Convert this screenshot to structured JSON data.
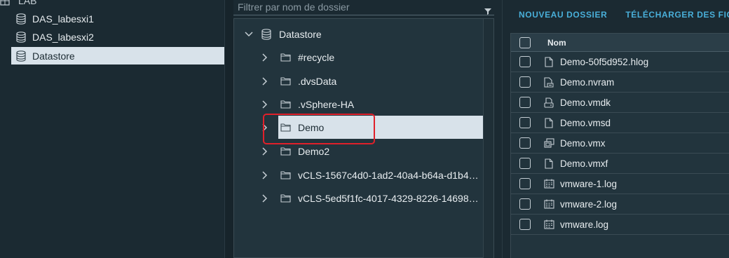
{
  "inventory": {
    "top_label": "LAB",
    "items": [
      {
        "label": "DAS_labesxi1",
        "icon": "datastore-icon"
      },
      {
        "label": "DAS_labesxi2",
        "icon": "datastore-icon"
      },
      {
        "label": "Datastore",
        "icon": "datastore-icon",
        "selected": true
      }
    ]
  },
  "filter": {
    "placeholder": "Filtrer par nom de dossier",
    "icon": "filter-icon"
  },
  "tree": {
    "root": {
      "label": "Datastore",
      "icon": "datastore-icon",
      "expanded": true
    },
    "folders": [
      {
        "label": "#recycle"
      },
      {
        "label": ".dvsData"
      },
      {
        "label": ".vSphere-HA"
      },
      {
        "label": "Demo",
        "selected": true
      },
      {
        "label": "Demo2"
      },
      {
        "label": "vCLS-1567c4d0-1ad2-40a4-b64a-d1b4aa..."
      },
      {
        "label": "vCLS-5ed5f1fc-4017-4329-8226-146988d..."
      }
    ]
  },
  "actions": {
    "new_folder": "NOUVEAU DOSSIER",
    "download": "TÉLÉCHARGER DES FICHI"
  },
  "files": {
    "column_name": "Nom",
    "rows": [
      {
        "name": "Demo-50f5d952.hlog",
        "icon": "file-icon"
      },
      {
        "name": "Demo.nvram",
        "icon": "nvram-file-icon"
      },
      {
        "name": "Demo.vmdk",
        "icon": "disk-file-icon"
      },
      {
        "name": "Demo.vmsd",
        "icon": "file-icon"
      },
      {
        "name": "Demo.vmx",
        "icon": "vm-config-icon"
      },
      {
        "name": "Demo.vmxf",
        "icon": "file-icon"
      },
      {
        "name": "vmware-1.log",
        "icon": "log-file-icon"
      },
      {
        "name": "vmware-2.log",
        "icon": "log-file-icon"
      },
      {
        "name": "vmware.log",
        "icon": "log-file-icon"
      }
    ]
  },
  "colors": {
    "accent": "#49afd9",
    "selected_bg": "#d8e2ea",
    "highlight": "#e0202a",
    "panel_bg": "#22343d"
  }
}
